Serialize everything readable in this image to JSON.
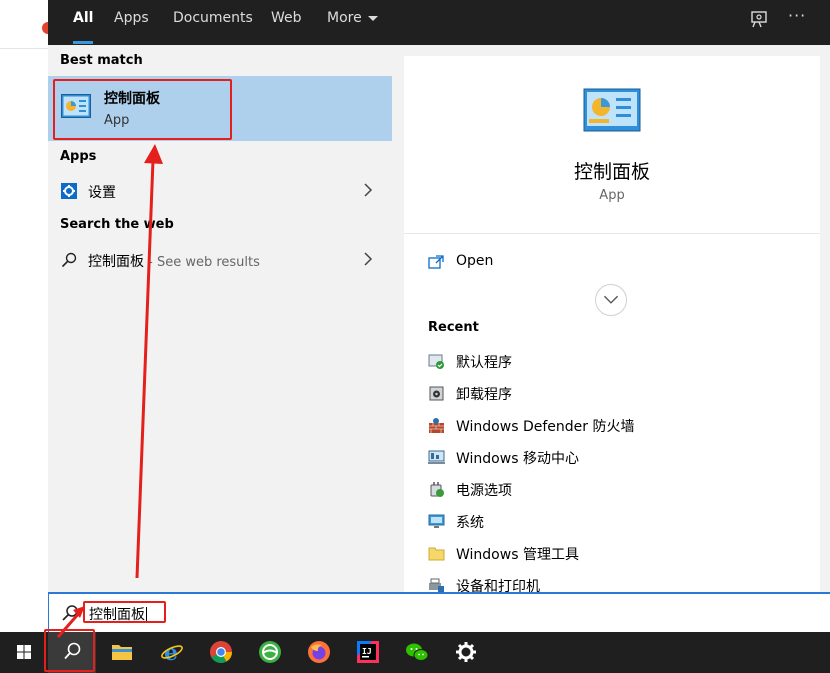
{
  "tabs": [
    {
      "label": "All"
    },
    {
      "label": "Apps"
    },
    {
      "label": "Documents"
    },
    {
      "label": "Web"
    },
    {
      "label": "More"
    }
  ],
  "left_pane": {
    "best_match_title": "Best match",
    "best_match": {
      "name": "控制面板",
      "type": "App"
    },
    "apps_title": "Apps",
    "apps": [
      {
        "label": "设置"
      }
    ],
    "web_title": "Search the web",
    "web_result": {
      "query": "控制面板",
      "suffix": " - See web results"
    }
  },
  "detail": {
    "name": "控制面板",
    "type": "App",
    "open_label": "Open",
    "recent_title": "Recent",
    "recent": [
      {
        "label": "默认程序",
        "icon": "default-programs-icon"
      },
      {
        "label": "卸载程序",
        "icon": "uninstall-icon"
      },
      {
        "label": "Windows Defender 防火墙",
        "icon": "firewall-icon"
      },
      {
        "label": "Windows 移动中心",
        "icon": "mobility-center-icon"
      },
      {
        "label": "电源选项",
        "icon": "power-options-icon"
      },
      {
        "label": "系统",
        "icon": "system-icon"
      },
      {
        "label": "Windows 管理工具",
        "icon": "folder-icon"
      },
      {
        "label": "设备和打印机",
        "icon": "printer-icon"
      }
    ]
  },
  "search": {
    "value": "控制面板"
  },
  "taskbar": [
    "start-icon",
    "search-icon",
    "file-explorer-icon",
    "ie-icon",
    "chrome-icon",
    "browser-360-icon",
    "firefox-icon",
    "intellij-icon",
    "wechat-icon",
    "settings-icon"
  ],
  "colors": {
    "accent": "#3a96dd",
    "selection": "#aed0ec",
    "annotation": "#e3201b"
  }
}
